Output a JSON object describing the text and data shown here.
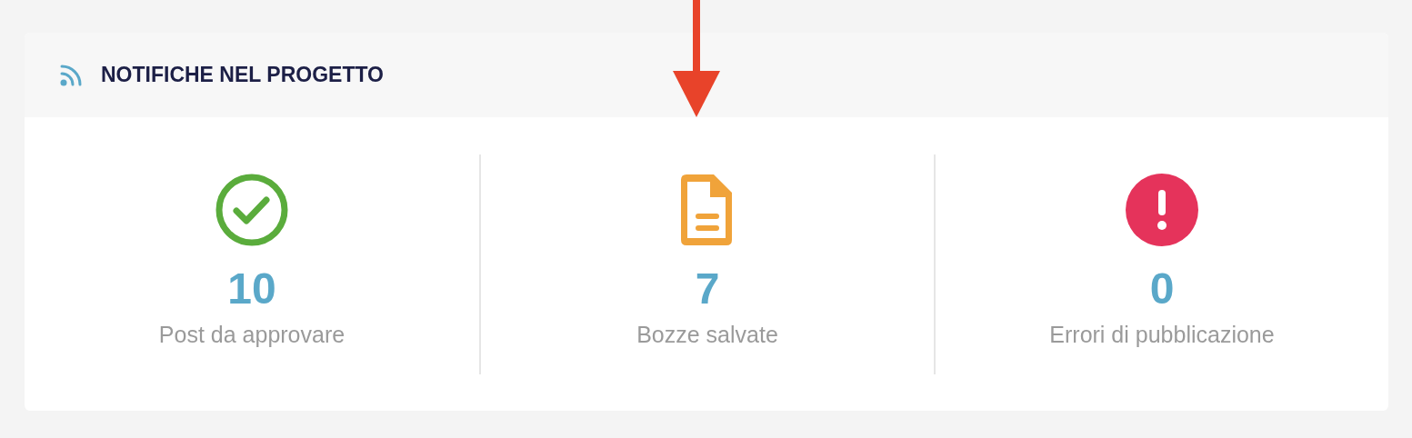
{
  "panel": {
    "title": "NOTIFICHE NEL PROGETTO"
  },
  "stats": [
    {
      "kind": "check",
      "color": "#5aac3c",
      "count": "10",
      "label": "Post da approvare"
    },
    {
      "kind": "document",
      "color": "#f0a33a",
      "count": "7",
      "label": "Bozze salvate"
    },
    {
      "kind": "error",
      "color": "#e5335b",
      "count": "0",
      "label": "Errori di pubblicazione"
    }
  ]
}
